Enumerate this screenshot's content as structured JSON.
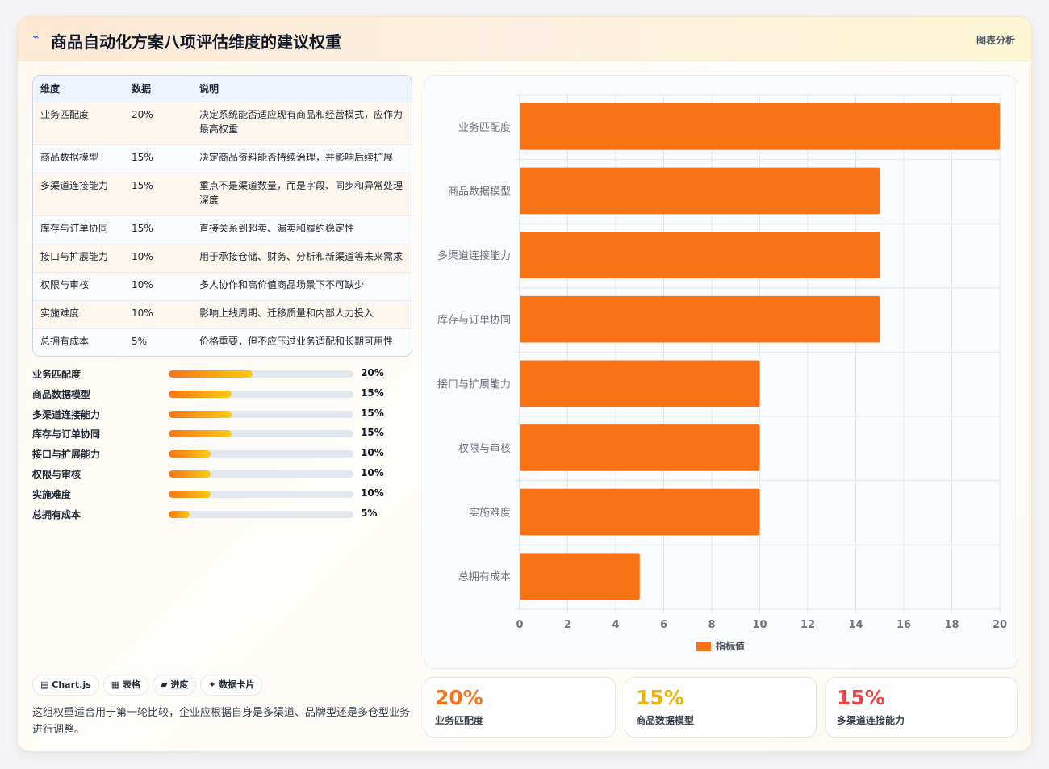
{
  "header": {
    "icon": "chart-line-icon",
    "title": "商品自动化方案八项评估维度的建议权重",
    "tag": "图表分析"
  },
  "table": {
    "headers": [
      "维度",
      "数据",
      "说明"
    ],
    "rows": [
      [
        "业务匹配度",
        "20%",
        "决定系统能否适应现有商品和经营模式，应作为最高权重"
      ],
      [
        "商品数据模型",
        "15%",
        "决定商品资料能否持续治理，并影响后续扩展"
      ],
      [
        "多渠道连接能力",
        "15%",
        "重点不是渠道数量，而是字段、同步和异常处理深度"
      ],
      [
        "库存与订单协同",
        "15%",
        "直接关系到超卖、漏卖和履约稳定性"
      ],
      [
        "接口与扩展能力",
        "10%",
        "用于承接仓储、财务、分析和新渠道等未来需求"
      ],
      [
        "权限与审核",
        "10%",
        "多人协作和高价值商品场景下不可缺少"
      ],
      [
        "实施难度",
        "10%",
        "影响上线周期、迁移质量和内部人力投入"
      ],
      [
        "总拥有成本",
        "5%",
        "价格重要，但不应压过业务适配和长期可用性"
      ]
    ]
  },
  "progress": [
    {
      "label": "业务匹配度",
      "value": 20,
      "text": "20%"
    },
    {
      "label": "商品数据模型",
      "value": 15,
      "text": "15%"
    },
    {
      "label": "多渠道连接能力",
      "value": 15,
      "text": "15%"
    },
    {
      "label": "库存与订单协同",
      "value": 15,
      "text": "15%"
    },
    {
      "label": "接口与扩展能力",
      "value": 10,
      "text": "10%"
    },
    {
      "label": "权限与审核",
      "value": 10,
      "text": "10%"
    },
    {
      "label": "实施难度",
      "value": 10,
      "text": "10%"
    },
    {
      "label": "总拥有成本",
      "value": 5,
      "text": "5%"
    }
  ],
  "chips": [
    {
      "icon": "chart-icon",
      "glyph": "▤",
      "label": "Chart.js"
    },
    {
      "icon": "table-icon",
      "glyph": "▦",
      "label": "表格"
    },
    {
      "icon": "progress-icon",
      "glyph": "▰",
      "label": "进度"
    },
    {
      "icon": "sparkle-icon",
      "glyph": "✦",
      "label": "数据卡片"
    }
  ],
  "note": "这组权重适合用于第一轮比较，企业应根据自身是多渠道、品牌型还是多仓型业务进行调整。",
  "chart_data": {
    "type": "bar",
    "orientation": "horizontal",
    "categories": [
      "业务匹配度",
      "商品数据模型",
      "多渠道连接能力",
      "库存与订单协同",
      "接口与扩展能力",
      "权限与审核",
      "实施难度",
      "总拥有成本"
    ],
    "series": [
      {
        "name": "指标值",
        "values": [
          20,
          15,
          15,
          15,
          10,
          10,
          10,
          5
        ],
        "color": "#f97316"
      }
    ],
    "xlim": [
      0,
      20
    ],
    "xticks": [
      0,
      2,
      4,
      6,
      8,
      10,
      12,
      14,
      16,
      18,
      20
    ],
    "grid": true,
    "legend": "bottom"
  },
  "stats": [
    {
      "value": "20%",
      "label": "业务匹配度",
      "color": "#f97316"
    },
    {
      "value": "15%",
      "label": "商品数据模型",
      "color": "#eab308"
    },
    {
      "value": "15%",
      "label": "多渠道连接能力",
      "color": "#ef4444"
    }
  ]
}
